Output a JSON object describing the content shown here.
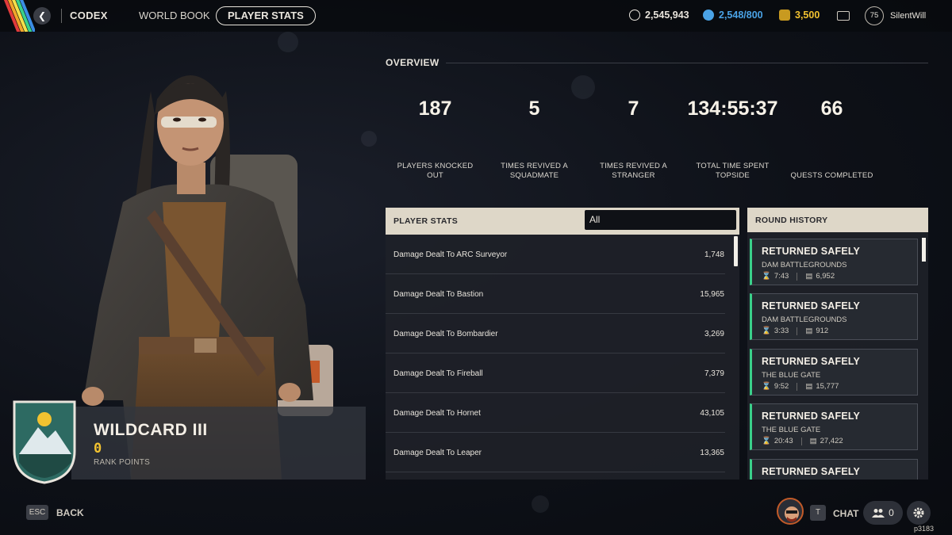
{
  "topbar": {
    "nav_codex": "CODEX",
    "nav_world_book": "WORLD BOOK",
    "nav_player_stats": "PLAYER STATS",
    "currencies": [
      {
        "icon": "coin-icon",
        "value": "2,545,943",
        "color": "#e8e4dc"
      },
      {
        "icon": "raider-token-icon",
        "value": "2,548/800",
        "color": "#4aa3e6"
      },
      {
        "icon": "cred-icon",
        "value": "3,500",
        "color": "#f2c230"
      }
    ],
    "mail_icon": "mail-icon",
    "level": "75",
    "username": "SilentWill"
  },
  "character": {
    "rank_title": "WILDCARD III",
    "rank_points": "0",
    "rank_points_label": "RANK POINTS"
  },
  "overview": {
    "title": "OVERVIEW",
    "stats": [
      {
        "value": "187",
        "label_lines": [
          "PLAYERS KNOCKED",
          "OUT"
        ]
      },
      {
        "value": "5",
        "label_lines": [
          "TIMES REVIVED A",
          "SQUADMATE"
        ]
      },
      {
        "value": "7",
        "label_lines": [
          "TIMES REVIVED A",
          "STRANGER"
        ]
      },
      {
        "value": "134:55:37",
        "label_lines": [
          "TOTAL TIME SPENT",
          "TOPSIDE"
        ]
      },
      {
        "value": "66",
        "label_lines": [
          "QUESTS COMPLETED"
        ]
      }
    ]
  },
  "player_stats": {
    "title": "PLAYER STATS",
    "filter_value": "All",
    "rows": [
      {
        "name": "Damage Dealt To ARC Surveyor",
        "value": "1,748"
      },
      {
        "name": "Damage Dealt To Bastion",
        "value": "15,965"
      },
      {
        "name": "Damage Dealt To Bombardier",
        "value": "3,269"
      },
      {
        "name": "Damage Dealt To Fireball",
        "value": "7,379"
      },
      {
        "name": "Damage Dealt To Hornet",
        "value": "43,105"
      },
      {
        "name": "Damage Dealt To Leaper",
        "value": "13,365"
      }
    ]
  },
  "round_history": {
    "title": "ROUND HISTORY",
    "rounds": [
      {
        "status": "RETURNED SAFELY",
        "map": "DAM BATTLEGROUNDS",
        "time": "7:43",
        "value": "6,952"
      },
      {
        "status": "RETURNED SAFELY",
        "map": "DAM BATTLEGROUNDS",
        "time": "3:33",
        "value": "912"
      },
      {
        "status": "RETURNED SAFELY",
        "map": "THE BLUE GATE",
        "time": "9:52",
        "value": "15,777"
      },
      {
        "status": "RETURNED SAFELY",
        "map": "THE BLUE GATE",
        "time": "20:43",
        "value": "27,422"
      },
      {
        "status": "RETURNED SAFELY",
        "map": "",
        "time": "",
        "value": ""
      }
    ]
  },
  "bottom": {
    "esc_key": "ESC",
    "back_label": "BACK",
    "chat_key": "T",
    "chat_label": "CHAT",
    "friends_count": "0",
    "build_id": "p3183"
  }
}
